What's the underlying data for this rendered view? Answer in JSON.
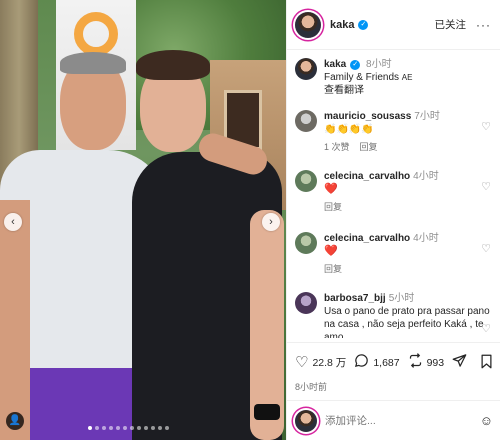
{
  "post": {
    "username": "kaka",
    "follow_status": "已关注",
    "more_label": "···",
    "caption_time": "8小时",
    "caption_text": "Family & Friends",
    "caption_flag": "AE",
    "translate_label": "查看翻译"
  },
  "carousel": {
    "prev_label": "‹",
    "next_label": "›",
    "dot_count": 12,
    "active_dot": 0
  },
  "comments": [
    {
      "user": "mauricio_sousass",
      "time": "7小时",
      "text": "👏👏👏👏",
      "likes": "1 次赞",
      "reply": "回复"
    },
    {
      "user": "celecina_carvalho",
      "time": "4小时",
      "text": "❤️",
      "reply": "回复"
    },
    {
      "user": "celecina_carvalho",
      "time": "4小时",
      "text": "❤️",
      "reply": "回复"
    },
    {
      "user": "barbosa7_bjj",
      "time": "5小时",
      "text": "Usa o pano de prato pra passar pano na casa , não seja perfeito Kaká , te amo"
    }
  ],
  "actions": {
    "likes": "22.8 万",
    "comments": "1,687",
    "reposts": "993",
    "date": "8小时前"
  },
  "add_comment": {
    "placeholder": "添加评论..."
  },
  "icons": {
    "heart": "heart-icon",
    "comment": "comment-icon",
    "repost": "repost-icon",
    "share": "share-icon",
    "save": "bookmark-icon",
    "emoji": "emoji-icon"
  }
}
